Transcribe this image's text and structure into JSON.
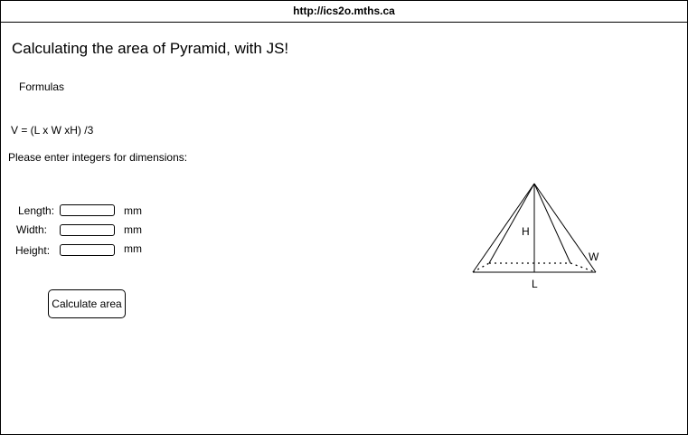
{
  "browser": {
    "url": "http://ics2o.mths.ca"
  },
  "page": {
    "title": "Calculating the area of Pyramid, with JS!",
    "formulas_heading": "Formulas",
    "formula": "V = (L x W xH) /3",
    "prompt": "Please enter integers for dimensions:"
  },
  "form": {
    "length": {
      "label": "Length:",
      "value": "",
      "unit": "mm"
    },
    "width": {
      "label": "Width:",
      "value": "",
      "unit": "mm"
    },
    "height": {
      "label": "Height:",
      "value": "",
      "unit": "mm"
    },
    "submit_label": "Calculate area"
  },
  "diagram": {
    "label_h": "H",
    "label_w": "W",
    "label_l": "L"
  }
}
